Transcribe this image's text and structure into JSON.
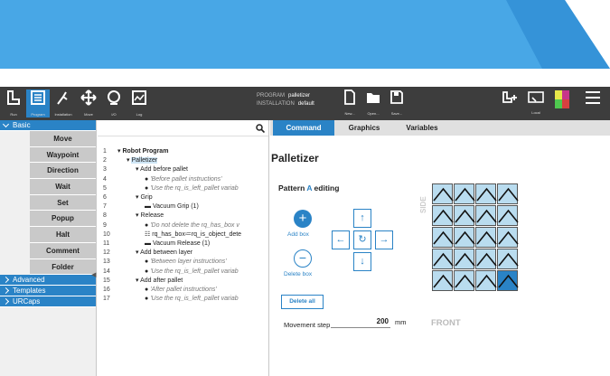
{
  "colors": {
    "accent": "#2a83c6",
    "banner_light": "#48a7e6",
    "banner_dark": "#3593d8",
    "topbar": "#3d3d3d"
  },
  "topbar": {
    "icons": [
      {
        "name": "run-icon",
        "label": "Run",
        "glyph": "R"
      },
      {
        "name": "program-icon",
        "label": "Program",
        "glyph": "☰"
      },
      {
        "name": "installation-icon",
        "label": "Installation",
        "glyph": "⚙"
      },
      {
        "name": "move-icon",
        "label": "Move",
        "glyph": "✥"
      },
      {
        "name": "io-icon",
        "label": "I/O",
        "glyph": "Ω"
      },
      {
        "name": "log-icon",
        "label": "Log",
        "glyph": "▣"
      }
    ],
    "program_label": "PROGRAM",
    "program_value": "palletizer",
    "installation_label": "INSTALLATION",
    "installation_value": "default",
    "new_label": "New...",
    "open_label": "Open...",
    "save_label": "Save...",
    "remote_label": "UR+",
    "local_label": "Local"
  },
  "sidebar": {
    "basic_label": "Basic",
    "basic_items": [
      "Move",
      "Waypoint",
      "Direction",
      "Wait",
      "Set",
      "Popup",
      "Halt",
      "Comment",
      "Folder"
    ],
    "other": [
      "Advanced",
      "Templates",
      "URCaps"
    ]
  },
  "tree": {
    "rows": [
      {
        "n": "1",
        "text": "Robot Program",
        "bold": true
      },
      {
        "n": "2",
        "text": "Palletizer"
      },
      {
        "n": "3",
        "text": "Add before pallet"
      },
      {
        "n": "4",
        "text": "'Before pallet instructions'"
      },
      {
        "n": "5",
        "text": "'Use the rq_is_left_pallet variab"
      },
      {
        "n": "6",
        "text": "Grip"
      },
      {
        "n": "7",
        "text": "Vacuum Grip  (1)"
      },
      {
        "n": "8",
        "text": "Release"
      },
      {
        "n": "9",
        "text": "'Do not delete the rq_has_box v"
      },
      {
        "n": "10",
        "text": "rq_has_box≔rq_is_object_dete"
      },
      {
        "n": "11",
        "text": "Vacuum Release  (1)"
      },
      {
        "n": "12",
        "text": "Add between layer"
      },
      {
        "n": "13",
        "text": "'Between layer instructions'"
      },
      {
        "n": "14",
        "text": "'Use the rq_is_left_pallet variab"
      },
      {
        "n": "15",
        "text": "Add after pallet"
      },
      {
        "n": "16",
        "text": "'After pallet instructions'"
      },
      {
        "n": "17",
        "text": "'Use the rq_is_left_pallet variab"
      }
    ]
  },
  "tabs": [
    "Command",
    "Graphics",
    "Variables"
  ],
  "panel": {
    "title": "Palletizer",
    "pattern_prefix": "Pattern ",
    "pattern_letter": "A",
    "pattern_suffix": " editing",
    "add_box": "Add box",
    "delete_box": "Delete box",
    "delete_all": "Delete all",
    "movement_step_label": "Movement step",
    "movement_step_value": "200",
    "movement_step_unit": "mm",
    "side_label": "SIDE",
    "front_label": "FRONT",
    "grid": {
      "rows": 5,
      "cols": 4,
      "selected": [
        [
          4,
          3
        ]
      ]
    }
  }
}
